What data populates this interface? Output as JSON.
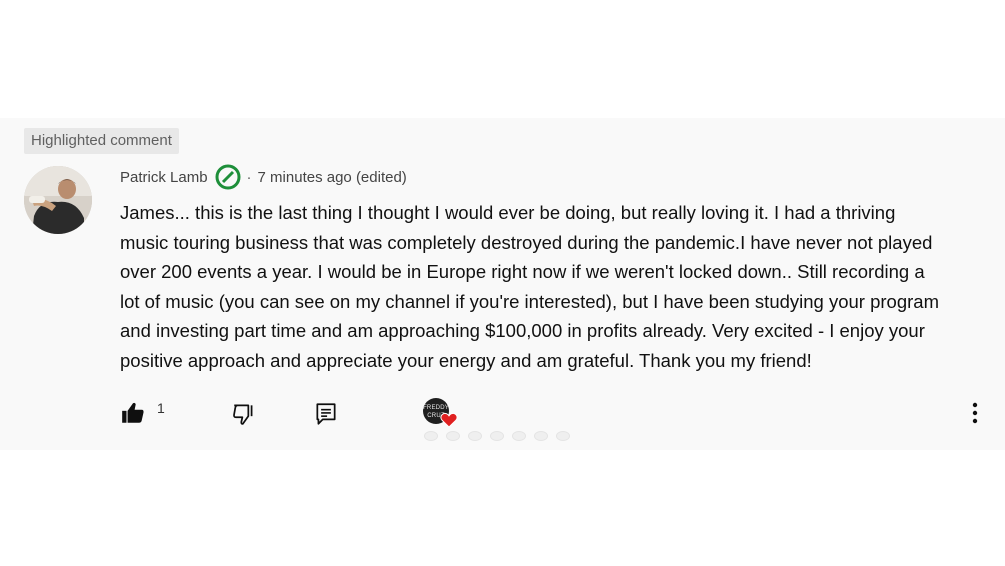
{
  "highlight_label": "Highlighted comment",
  "comment": {
    "author": "Patrick Lamb",
    "separator": "·",
    "time": "7 minutes ago (edited)",
    "lines": [
      "James... this is the last thing I thought I would ever be doing, but really loving it. I had a thriving",
      "music touring business that was completely destroyed during the pandemic.I have never not played",
      "over 200 events a year. I would be in Europe right now if we weren't locked down.. Still recording a",
      "lot of music (you can see on my channel if you're interested), but I have been studying your program",
      "and investing part time and am approaching $100,000  in profits already. Very excited - I enjoy your",
      "positive approach and appreciate your energy and am grateful. Thank you my friend!"
    ]
  },
  "actions": {
    "like_count": "1",
    "creator_avatar_text": "FREDDY CRUZ"
  },
  "icons": {
    "verified": "circle-slash-icon",
    "like": "thumbs-up-filled-icon",
    "dislike": "thumbs-down-outline-icon",
    "reply": "reply-comment-icon",
    "heart": "heart-icon",
    "menu": "more-vertical-icon"
  },
  "colors": {
    "verified_green": "#1e8f3a",
    "heart_red": "#e02020",
    "badge_bg": "#e8e8e8"
  }
}
